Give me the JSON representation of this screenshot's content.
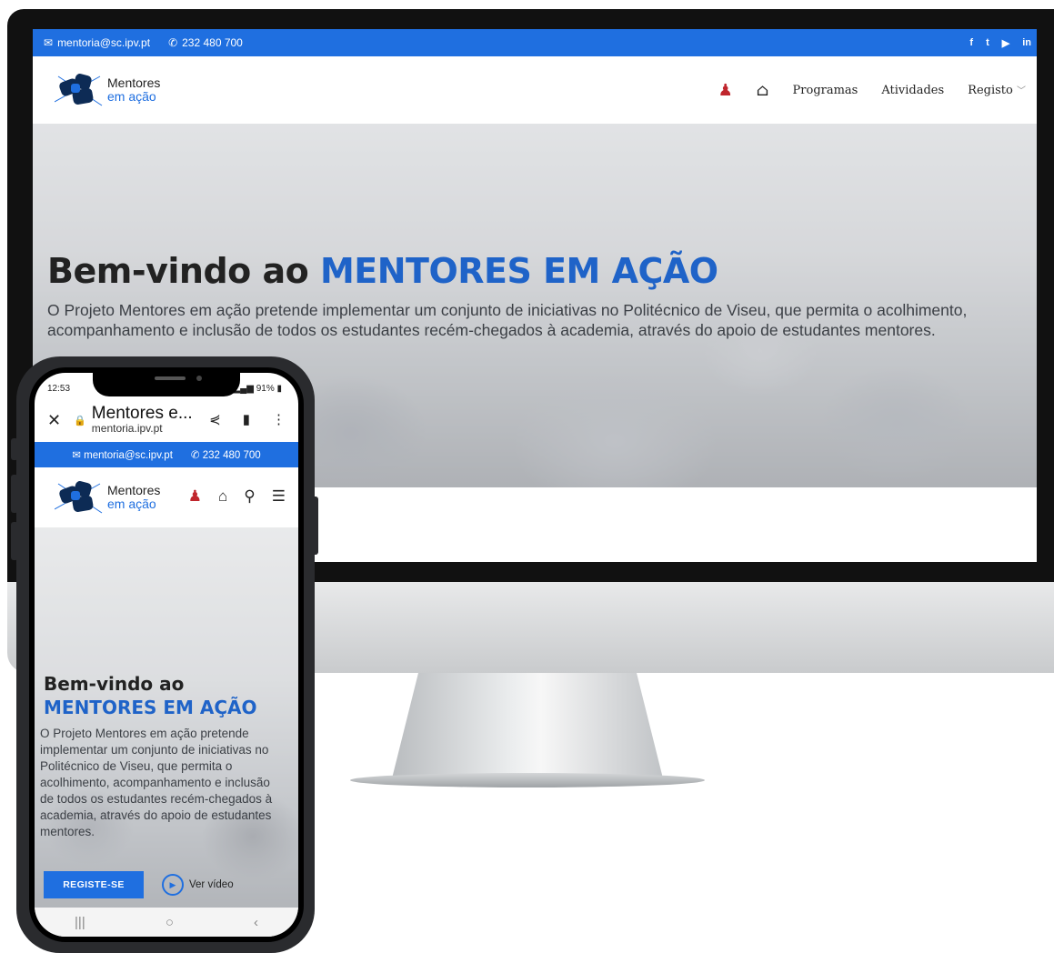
{
  "desktop": {
    "topbar": {
      "email": "mentoria@sc.ipv.pt",
      "phone": "232 480 700",
      "social": [
        "facebook-icon",
        "twitter-icon",
        "youtube-icon",
        "linkedin-icon"
      ]
    },
    "logo": {
      "line1": "Mentores",
      "line2": "em ação"
    },
    "nav": {
      "items": [
        "Programas",
        "Atividades",
        "Registo"
      ]
    },
    "hero": {
      "title_plain": "Bem-vindo ao ",
      "title_accent": "MENTORES EM AÇÃO",
      "text": "O Projeto Mentores em ação pretende implementar um conjunto de iniciativas no Politécnico de Viseu, que permita o acolhimento, acompanhamento e inclusão de todos os estudantes recém-chegados à academia, através do apoio de estudantes mentores."
    }
  },
  "mobile": {
    "status": {
      "time": "12:53",
      "battery": "91%"
    },
    "browser": {
      "title": "Mentores e...",
      "url": "mentoria.ipv.pt"
    },
    "topbar": {
      "email": "mentoria@sc.ipv.pt",
      "phone": "232 480 700"
    },
    "logo": {
      "line1": "Mentores",
      "line2": "em ação"
    },
    "hero": {
      "title1": "Bem-vindo ao",
      "title2": "MENTORES EM AÇÃO",
      "text": "O Projeto Mentores em ação pretende implementar um conjunto de iniciativas no Politécnico de Viseu, que permita o acolhimento, acompanhamento e inclusão de todos os estudantes recém-chegados à academia, através do apoio de estudantes mentores.",
      "cta": "REGISTE-SE",
      "video": "Ver vídeo"
    }
  },
  "colors": {
    "brand_blue": "#1f6fe0",
    "accent_title": "#1f63c8",
    "user_icon_red": "#c0262d"
  }
}
